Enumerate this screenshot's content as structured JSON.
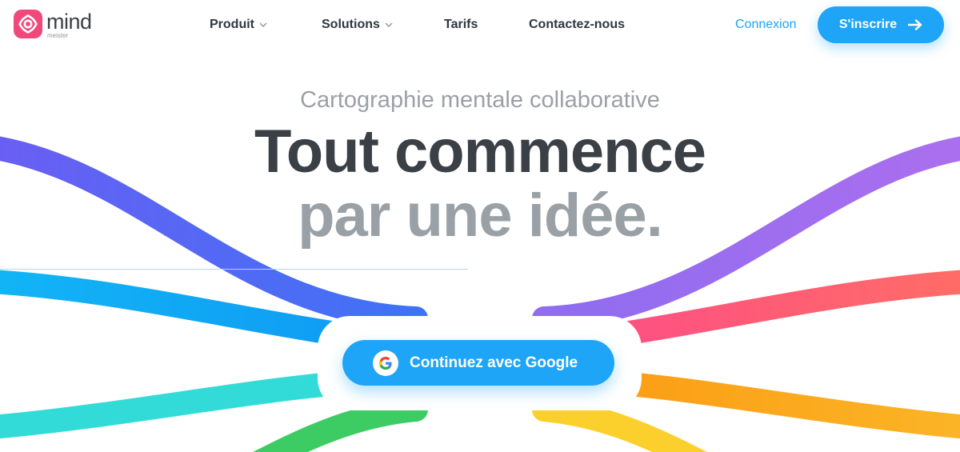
{
  "brand": {
    "name": "mind",
    "sub": "meister",
    "logo_color": "#f0487a"
  },
  "nav": {
    "items": [
      {
        "label": "Produit",
        "has_dropdown": true
      },
      {
        "label": "Solutions",
        "has_dropdown": true
      },
      {
        "label": "Tarifs",
        "has_dropdown": false
      },
      {
        "label": "Contactez-nous",
        "has_dropdown": false
      }
    ],
    "login_label": "Connexion",
    "signup_label": "S'inscrire"
  },
  "hero": {
    "subtitle": "Cartographie mentale collaborative",
    "title_line1": "Tout commence",
    "title_line2": "par une idée.",
    "cta_label": "Continuez avec Google"
  },
  "icons": {
    "logo": "mindmeister-logo-icon",
    "dropdown": "chevron-down-icon",
    "signup": "arrow-right-icon",
    "google": "google-g-icon"
  },
  "colors": {
    "accent": "#1ea5f7",
    "text_dark": "#3a4046",
    "text_grey": "#9aa1a6",
    "branch_left_1": "#5b6cf2",
    "branch_left_2": "#10a9f5",
    "branch_left_3": "#33dbd8",
    "branch_left_4": "#3dcc64",
    "branch_right_1": "#a470ee",
    "branch_right_2": "#fd5a78",
    "branch_right_3": "#fba916",
    "branch_right_4": "#fcd02c"
  }
}
